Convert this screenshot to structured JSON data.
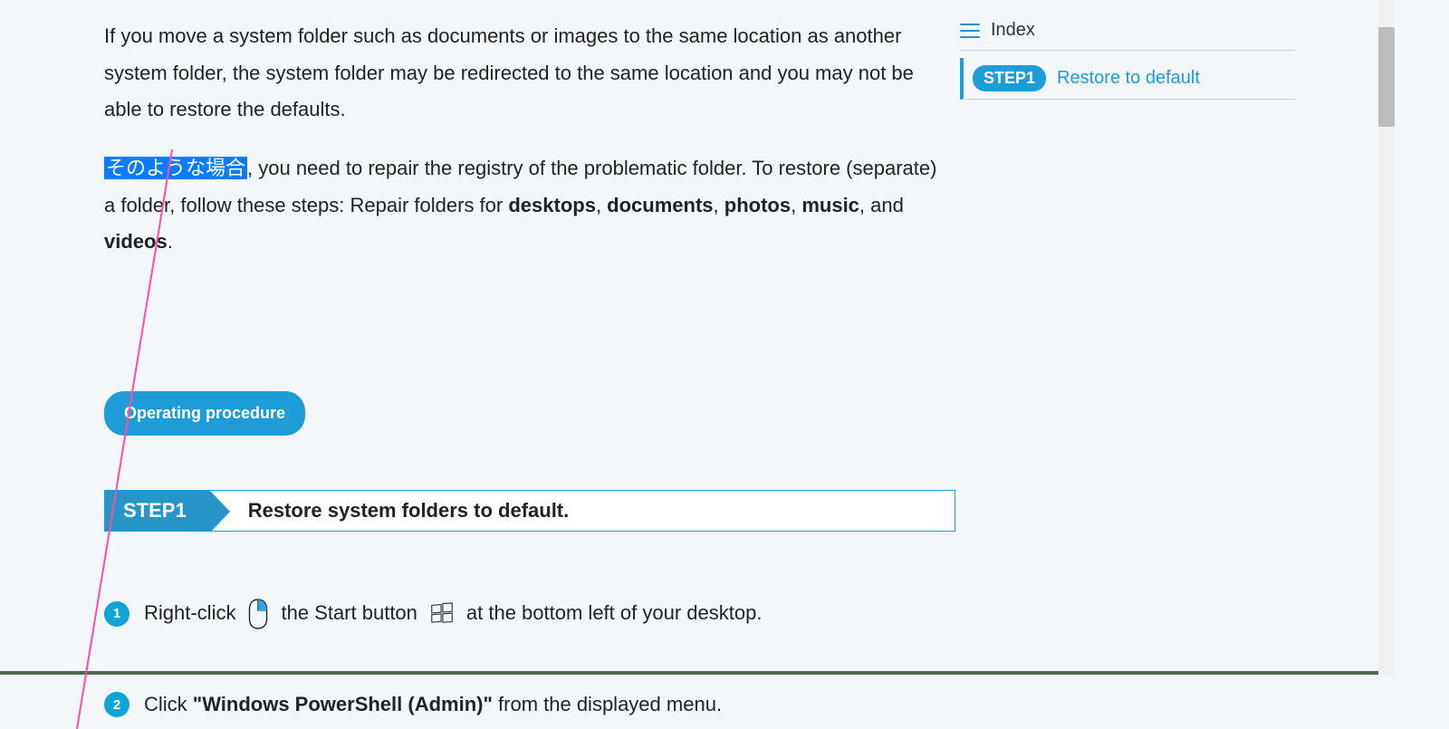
{
  "intro": {
    "p1": "If you move a system folder such as documents or images to the same location as another system folder, the system folder may be redirected to the same location and you may not be able to restore the defaults.",
    "p2_highlight": "そのような場合",
    "p2_a": ", you need to repair the registry of the problematic folder. To restore (separate) a folder, follow these steps: Repair folders for ",
    "b1": "desktops",
    "sep1": ", ",
    "b2": "documents",
    "sep2": ", ",
    "b3": "photos",
    "sep3": ", ",
    "b4": "music",
    "sep4": ", and ",
    "b5": "videos",
    "end": "."
  },
  "procedure_label": "Operating procedure",
  "step1": {
    "badge": "STEP1",
    "title": "Restore system folders to default."
  },
  "instructions": {
    "i1": {
      "num": "1",
      "a": "Right-click",
      "b": "the Start button",
      "c": "at the bottom left of your desktop."
    },
    "i2": {
      "num": "2",
      "a": "Click ",
      "q": "\"Windows PowerShell (Admin)\"",
      "b": " from the displayed menu."
    }
  },
  "index": {
    "title": "Index",
    "item1_chip": "STEP1",
    "item1_link": "Restore to default"
  }
}
